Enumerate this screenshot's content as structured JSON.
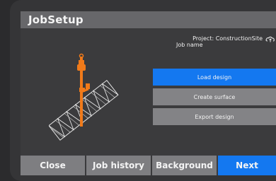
{
  "window": {
    "title": "JobSetup"
  },
  "project": {
    "project_line": "Project: ConstructionSite",
    "job_name_label": "Job name"
  },
  "actions": {
    "load_design": "Load design",
    "create_surface": "Create surface",
    "export_design": "Export design"
  },
  "bottom_bar": {
    "close": "Close",
    "job_history": "Job history",
    "background": "Background",
    "next": "Next"
  },
  "icons": {
    "cloud": "cloud-sync-icon",
    "illustration": "excavator-design-icon"
  },
  "colors": {
    "accent": "#1478f0",
    "button_gray": "#838386",
    "title_bar": "#67676a",
    "machine_orange": "#f07a1a"
  }
}
